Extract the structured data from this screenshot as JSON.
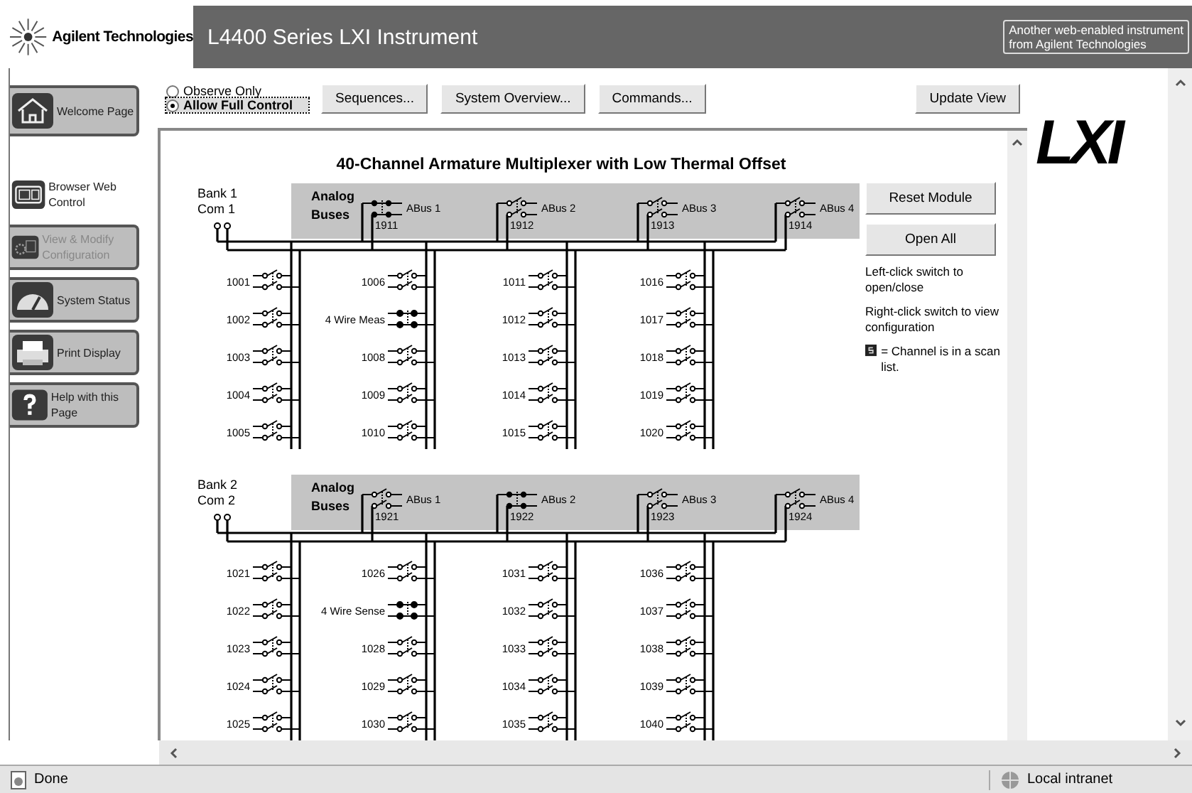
{
  "header": {
    "brand": "Agilent Technologies",
    "title": "L4400 Series LXI Instrument",
    "badge_lines": [
      "Another web-enabled instrument",
      "from Agilent Technologies"
    ]
  },
  "sidebar": [
    {
      "label": "Welcome Page",
      "kind": "home",
      "selected": false,
      "disabled": false
    },
    {
      "label": "Browser Web Control",
      "kind": "control",
      "selected": true,
      "disabled": false
    },
    {
      "label": "View & Modify Configuration",
      "kind": "config",
      "selected": false,
      "disabled": true
    },
    {
      "label": "System Status",
      "kind": "status",
      "selected": false,
      "disabled": false
    },
    {
      "label": "Print Display",
      "kind": "print",
      "selected": false,
      "disabled": false
    },
    {
      "label": "Help with this Page",
      "kind": "help",
      "selected": false,
      "disabled": false
    }
  ],
  "control_mode": [
    {
      "label": "Observe Only",
      "selected": false
    },
    {
      "label": "Allow Full Control",
      "selected": true
    }
  ],
  "toolbar_buttons": [
    "Sequences...",
    "System Overview...",
    "Commands..."
  ],
  "update_button": "Update View",
  "logo": "LXI",
  "module": {
    "title": "40-Channel Armature Multiplexer with Low Thermal Offset",
    "banks": [
      {
        "bank_label": "Bank 1",
        "com_label": "Com 1",
        "bus_label": [
          "Analog",
          "Buses"
        ],
        "buses": [
          {
            "name": "ABus 1",
            "number": "1911",
            "closed": true
          },
          {
            "name": "ABus 2",
            "number": "1912",
            "closed": false
          },
          {
            "name": "ABus 3",
            "number": "1913",
            "closed": false
          },
          {
            "name": "ABus 4",
            "number": "1914",
            "closed": false
          }
        ],
        "columns": [
          {
            "channels": [
              {
                "label": "1001",
                "closed": false
              },
              {
                "label": "1002",
                "closed": false
              },
              {
                "label": "1003",
                "closed": false
              },
              {
                "label": "1004",
                "closed": false
              },
              {
                "label": "1005",
                "closed": false
              }
            ]
          },
          {
            "channels": [
              {
                "label": "1006",
                "closed": false
              },
              {
                "label": "4 Wire Meas",
                "closed": true
              },
              {
                "label": "1008",
                "closed": false
              },
              {
                "label": "1009",
                "closed": false
              },
              {
                "label": "1010",
                "closed": false
              }
            ]
          },
          {
            "channels": [
              {
                "label": "1011",
                "closed": false
              },
              {
                "label": "1012",
                "closed": false
              },
              {
                "label": "1013",
                "closed": false
              },
              {
                "label": "1014",
                "closed": false
              },
              {
                "label": "1015",
                "closed": false
              }
            ]
          },
          {
            "channels": [
              {
                "label": "1016",
                "closed": false
              },
              {
                "label": "1017",
                "closed": false
              },
              {
                "label": "1018",
                "closed": false
              },
              {
                "label": "1019",
                "closed": false
              },
              {
                "label": "1020",
                "closed": false
              }
            ]
          }
        ]
      },
      {
        "bank_label": "Bank 2",
        "com_label": "Com 2",
        "bus_label": [
          "Analog",
          "Buses"
        ],
        "buses": [
          {
            "name": "ABus 1",
            "number": "1921",
            "closed": false
          },
          {
            "name": "ABus 2",
            "number": "1922",
            "closed": true
          },
          {
            "name": "ABus 3",
            "number": "1923",
            "closed": false
          },
          {
            "name": "ABus 4",
            "number": "1924",
            "closed": false
          }
        ],
        "columns": [
          {
            "channels": [
              {
                "label": "1021",
                "closed": false
              },
              {
                "label": "1022",
                "closed": false
              },
              {
                "label": "1023",
                "closed": false
              },
              {
                "label": "1024",
                "closed": false
              },
              {
                "label": "1025",
                "closed": false
              }
            ]
          },
          {
            "channels": [
              {
                "label": "1026",
                "closed": false
              },
              {
                "label": "4 Wire Sense",
                "closed": true
              },
              {
                "label": "1028",
                "closed": false
              },
              {
                "label": "1029",
                "closed": false
              },
              {
                "label": "1030",
                "closed": false
              }
            ]
          },
          {
            "channels": [
              {
                "label": "1031",
                "closed": false
              },
              {
                "label": "1032",
                "closed": false
              },
              {
                "label": "1033",
                "closed": false
              },
              {
                "label": "1034",
                "closed": false
              },
              {
                "label": "1035",
                "closed": false
              }
            ]
          },
          {
            "channels": [
              {
                "label": "1036",
                "closed": false
              },
              {
                "label": "1037",
                "closed": false
              },
              {
                "label": "1038",
                "closed": false
              },
              {
                "label": "1039",
                "closed": false
              },
              {
                "label": "1040",
                "closed": false
              }
            ]
          }
        ]
      }
    ]
  },
  "side_buttons": [
    "Reset Module",
    "Open All"
  ],
  "help_texts": [
    "Left-click switch to open/close",
    "Right-click switch to view configuration"
  ],
  "scan_note": "= Channel is in a scan list.",
  "status_bar": {
    "text": "Done",
    "zone": "Local intranet"
  }
}
